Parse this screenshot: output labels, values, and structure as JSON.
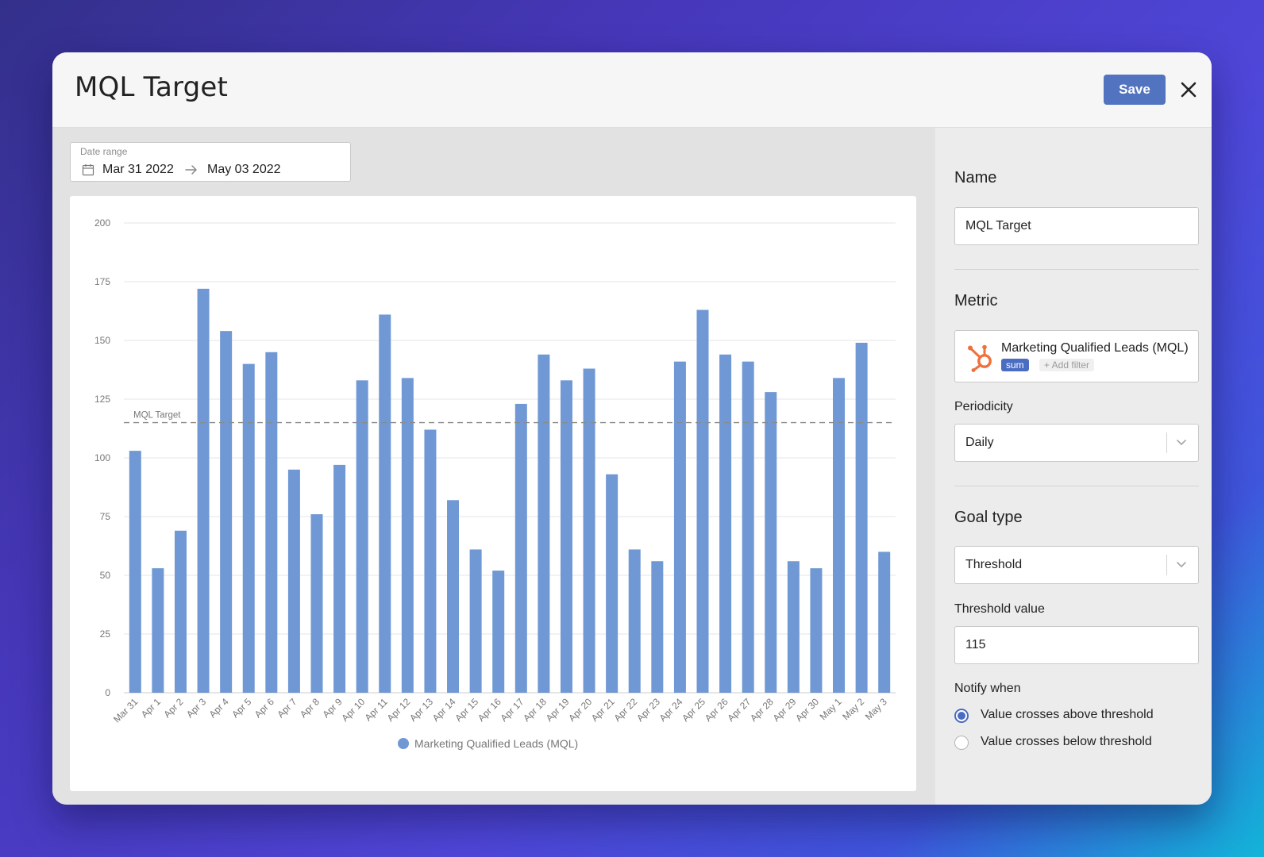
{
  "header": {
    "title": "MQL Target",
    "save_label": "Save"
  },
  "date_range": {
    "label": "Date range",
    "start": "Mar 31 2022",
    "end": "May 03 2022"
  },
  "chart_data": {
    "type": "bar",
    "title": "",
    "xlabel": "",
    "ylabel": "",
    "ylim": [
      0,
      200
    ],
    "yticks": [
      0,
      25,
      50,
      75,
      100,
      125,
      150,
      175,
      200
    ],
    "grid": true,
    "categories": [
      "Mar 31",
      "Apr 1",
      "Apr 2",
      "Apr 3",
      "Apr 4",
      "Apr 5",
      "Apr 6",
      "Apr 7",
      "Apr 8",
      "Apr 9",
      "Apr 10",
      "Apr 11",
      "Apr 12",
      "Apr 13",
      "Apr 14",
      "Apr 15",
      "Apr 16",
      "Apr 17",
      "Apr 18",
      "Apr 19",
      "Apr 20",
      "Apr 21",
      "Apr 22",
      "Apr 23",
      "Apr 24",
      "Apr 25",
      "Apr 26",
      "Apr 27",
      "Apr 28",
      "Apr 29",
      "Apr 30",
      "May 1",
      "May 2",
      "May 3"
    ],
    "series": [
      {
        "name": "Marketing Qualified Leads (MQL)",
        "color": "#7098d4",
        "values": [
          103,
          53,
          69,
          172,
          154,
          140,
          145,
          95,
          76,
          97,
          133,
          161,
          134,
          112,
          82,
          61,
          52,
          123,
          144,
          133,
          138,
          93,
          61,
          56,
          141,
          163,
          144,
          141,
          128,
          56,
          53,
          134,
          149,
          60
        ]
      }
    ],
    "target_line": {
      "label": "MQL Target",
      "value": 115
    },
    "legend_position": "bottom"
  },
  "side_panel": {
    "name_label": "Name",
    "name_value": "MQL Target",
    "metric_label": "Metric",
    "metric": {
      "name": "Marketing Qualified Leads (MQL)",
      "icon": "hubspot-icon",
      "aggregation": "sum",
      "add_filter": "+ Add filter"
    },
    "periodicity_label": "Periodicity",
    "periodicity_value": "Daily",
    "goal_type_label": "Goal type",
    "goal_type_value": "Threshold",
    "threshold_label": "Threshold value",
    "threshold_value": "115",
    "notify_label": "Notify when",
    "notify_options": [
      {
        "label": "Value crosses above threshold",
        "checked": true
      },
      {
        "label": "Value crosses below threshold",
        "checked": false
      }
    ]
  },
  "colors": {
    "accent": "#4a6cc3",
    "save_button": "#5273c0",
    "bar": "#7098d4",
    "hubspot": "#f0703c"
  }
}
